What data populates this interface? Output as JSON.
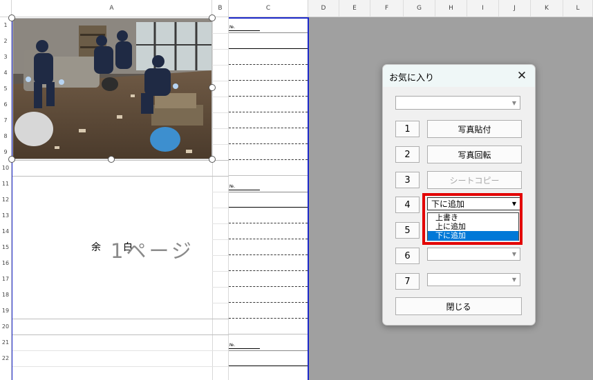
{
  "sheet": {
    "column_headers": [
      "A",
      "B",
      "C",
      "D",
      "E",
      "F",
      "G",
      "H",
      "I",
      "J",
      "K",
      "L"
    ],
    "row_headers": [
      "1",
      "2",
      "3",
      "4",
      "5",
      "6",
      "7",
      "8",
      "9",
      "10",
      "11",
      "12",
      "13",
      "14",
      "15",
      "16",
      "17",
      "18",
      "19",
      "20",
      "21",
      "22"
    ],
    "form_no_label": "№.",
    "yohaku_left": "余",
    "yohaku_right": "白",
    "page_label": "1ページ"
  },
  "dialog": {
    "title": "お気に入り",
    "close": "✕",
    "top_combo_value": "",
    "rows": [
      {
        "num": "1",
        "action": "写真貼付"
      },
      {
        "num": "2",
        "action": "写真回転"
      },
      {
        "num": "3",
        "action": "シートコピー"
      },
      {
        "num": "4",
        "combo_value": "下に追加"
      },
      {
        "num": "5",
        "combo_value": ""
      },
      {
        "num": "6",
        "combo_value": ""
      },
      {
        "num": "7",
        "combo_value": ""
      }
    ],
    "dropdown_options": [
      "上書き",
      "上に追加",
      "下に追加"
    ],
    "dropdown_selected": "下に追加",
    "close_button": "閉じる"
  },
  "colors": {
    "accent_blue": "#1b27c9",
    "highlight_red": "#e30000",
    "selection_blue": "#0078d7"
  }
}
